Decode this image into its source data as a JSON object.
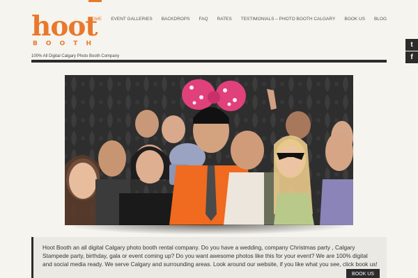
{
  "brand": {
    "logo_main": "hoot",
    "logo_letters": [
      "B",
      "O",
      "O",
      "T",
      "H"
    ],
    "tagline": "100% All Digital Calgary Photo Booth Company",
    "accent_color": "#e8792b"
  },
  "nav": {
    "items": [
      {
        "label": "HOME",
        "active": true
      },
      {
        "label": "EVENT GALLERIES",
        "active": false
      },
      {
        "label": "BACKDROPS",
        "active": false
      },
      {
        "label": "FAQ",
        "active": false
      },
      {
        "label": "RATES",
        "active": false
      },
      {
        "label": "TESTIMONIALS – PHOTO BOOTH CALGARY",
        "active": false
      },
      {
        "label": "BOOK US",
        "active": false
      },
      {
        "label": "BLOG",
        "active": false
      }
    ]
  },
  "social": {
    "twitter_glyph": "t",
    "facebook_glyph": "f",
    "twitter_icon": "twitter-icon",
    "facebook_icon": "facebook-icon"
  },
  "hero": {
    "icon": "photo-booth-group-photo"
  },
  "intro": {
    "text": "Hoot Booth an all digital Calgary photo booth rental company. Do you have a wedding, company Christmas party , Calgary Stampede party, birthday, gala or event coming up?  Do you want awesome photos like this for your event?  We are 100% digital and social media ready. We serve Calgary and surrounding areas. Look around our website, if you like what you see, click book us!",
    "button_label": "BOOK US"
  }
}
